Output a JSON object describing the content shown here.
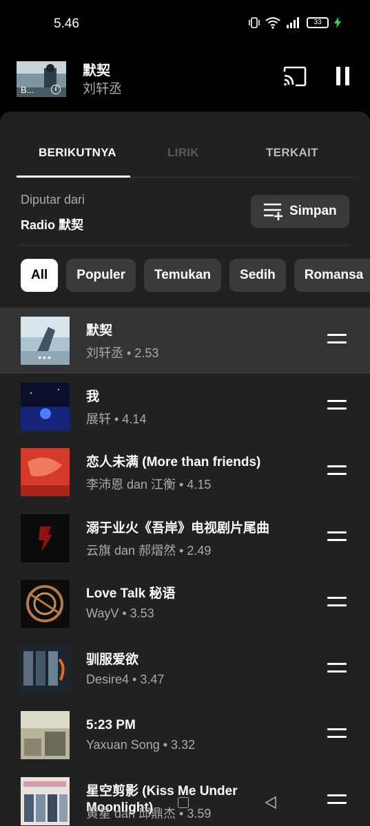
{
  "status_bar": {
    "time": "5.46",
    "battery": "33"
  },
  "mini_player": {
    "art_caption": "B...",
    "title": "默契",
    "artist": "刘轩丞"
  },
  "tabs": [
    {
      "label": "BERIKUTNYA"
    },
    {
      "label": "LIRIK"
    },
    {
      "label": "TERKAIT"
    }
  ],
  "queue_source": {
    "label": "Diputar dari",
    "name": "Radio 默契"
  },
  "save_label": "Simpan",
  "chips": [
    "All",
    "Populer",
    "Temukan",
    "Sedih",
    "Romansa"
  ],
  "songs": [
    {
      "title": "默契",
      "subtitle": "刘轩丞 • 2.53"
    },
    {
      "title": "我",
      "subtitle": "展轩 • 4.14"
    },
    {
      "title": "恋人未满 (More than friends)",
      "subtitle": "李沛恩 dan 江衡 • 4.15"
    },
    {
      "title": "溺于业火《吾岸》电视剧片尾曲",
      "subtitle": "云旗 dan 郝熠然 • 2.49"
    },
    {
      "title": "Love Talk 秘语",
      "subtitle": "WayV • 3.53"
    },
    {
      "title": "驯服爱欲",
      "subtitle": "Desire4 • 3.47"
    },
    {
      "title": "5:23 PM",
      "subtitle": "Yaxuan Song • 3.32"
    },
    {
      "title": "星空剪影 (Kiss Me Under Moonlight)",
      "subtitle": "黄星 dan 邱鼎杰 • 3.59"
    }
  ],
  "colors": {
    "background": "#000000",
    "sheet": "#212121",
    "chip": "#3a3a3a",
    "current_row": "#333333"
  }
}
